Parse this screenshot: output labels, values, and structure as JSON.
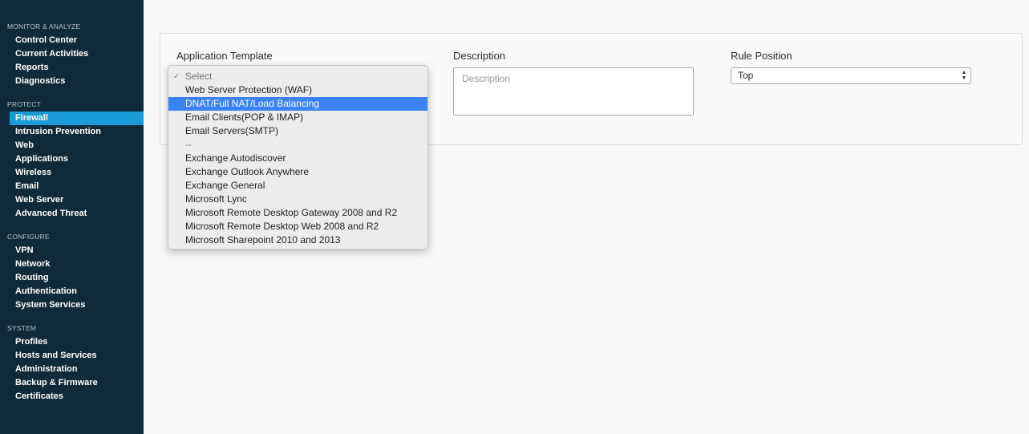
{
  "sidebar": {
    "groups": [
      {
        "heading": "MONITOR & ANALYZE",
        "items": [
          "Control Center",
          "Current Activities",
          "Reports",
          "Diagnostics"
        ]
      },
      {
        "heading": "PROTECT",
        "items": [
          "Firewall",
          "Intrusion Prevention",
          "Web",
          "Applications",
          "Wireless",
          "Email",
          "Web Server",
          "Advanced Threat"
        ]
      },
      {
        "heading": "CONFIGURE",
        "items": [
          "VPN",
          "Network",
          "Routing",
          "Authentication",
          "System Services"
        ]
      },
      {
        "heading": "SYSTEM",
        "items": [
          "Profiles",
          "Hosts and Services",
          "Administration",
          "Backup & Firmware",
          "Certificates"
        ]
      }
    ],
    "active_item": "Firewall"
  },
  "form": {
    "app_template_label": "Application Template",
    "description_label": "Description",
    "description_placeholder": "Description",
    "rule_position_label": "Rule Position",
    "rule_position_value": "Top"
  },
  "dropdown": {
    "selected": "Select",
    "highlighted": "DNAT/Full NAT/Load Balancing",
    "options": [
      "Select",
      "Web Server Protection (WAF)",
      "DNAT/Full NAT/Load Balancing",
      "Email Clients(POP & IMAP)",
      "Email Servers(SMTP)",
      "--",
      "Exchange Autodiscover",
      "Exchange Outlook Anywhere",
      "Exchange General",
      "Microsoft Lync",
      "Microsoft Remote Desktop Gateway 2008 and R2",
      "Microsoft Remote Desktop Web 2008 and R2",
      "Microsoft Sharepoint 2010 and 2013"
    ]
  },
  "colors": {
    "sidebar_bg": "#0f2a3a",
    "active_item": "#1a9ad6",
    "highlight": "#3b82f6"
  }
}
